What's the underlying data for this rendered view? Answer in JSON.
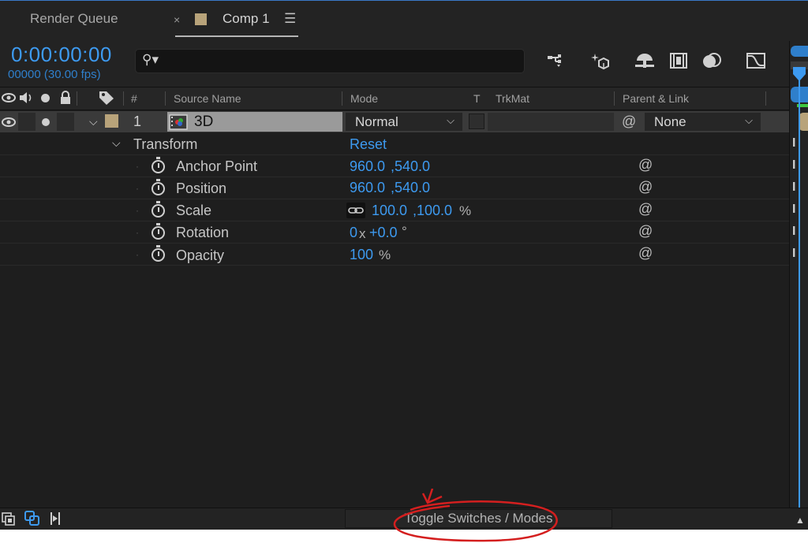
{
  "tabs": {
    "render_queue": "Render Queue",
    "close": "×",
    "comp": "Comp 1",
    "menu": "☰"
  },
  "header": {
    "timecode": "0:00:00:00",
    "frames": "00000 (30.00 fps)",
    "search_icon": "⚲▾"
  },
  "toolbar_icons": [
    "draft-3d-icon",
    "comp-flowchart-icon",
    "motion-blur-icon",
    "frame-blend-icon",
    "shy-icon",
    "graph-editor-icon"
  ],
  "columns": {
    "num": "#",
    "source_name": "Source Name",
    "mode": "Mode",
    "t": "T",
    "trkmat": "TrkMat",
    "parent": "Parent & Link"
  },
  "layer": {
    "number": "1",
    "name": "3D",
    "mode": "Normal",
    "parent": "None"
  },
  "transform": {
    "label": "Transform",
    "reset": "Reset",
    "props": [
      {
        "label": "Anchor Point",
        "v1": "960.0",
        "v2": ",540.0",
        "unit": ""
      },
      {
        "label": "Position",
        "v1": "960.0",
        "v2": ",540.0",
        "unit": ""
      },
      {
        "label": "Scale",
        "v1": "100.0",
        "v2": ",100.0",
        "unit": "%"
      },
      {
        "label": "Rotation",
        "v1": "0",
        "v2": "+0.0",
        "unit": "°",
        "x": "x"
      },
      {
        "label": "Opacity",
        "v1": "100",
        "v2": "",
        "unit": "%"
      }
    ]
  },
  "bottom": {
    "toggle": "Toggle Switches / Modes"
  },
  "colors": {
    "accent": "#3d9af0",
    "swatch": "#b8a37a",
    "annotation": "#d41f1f"
  }
}
